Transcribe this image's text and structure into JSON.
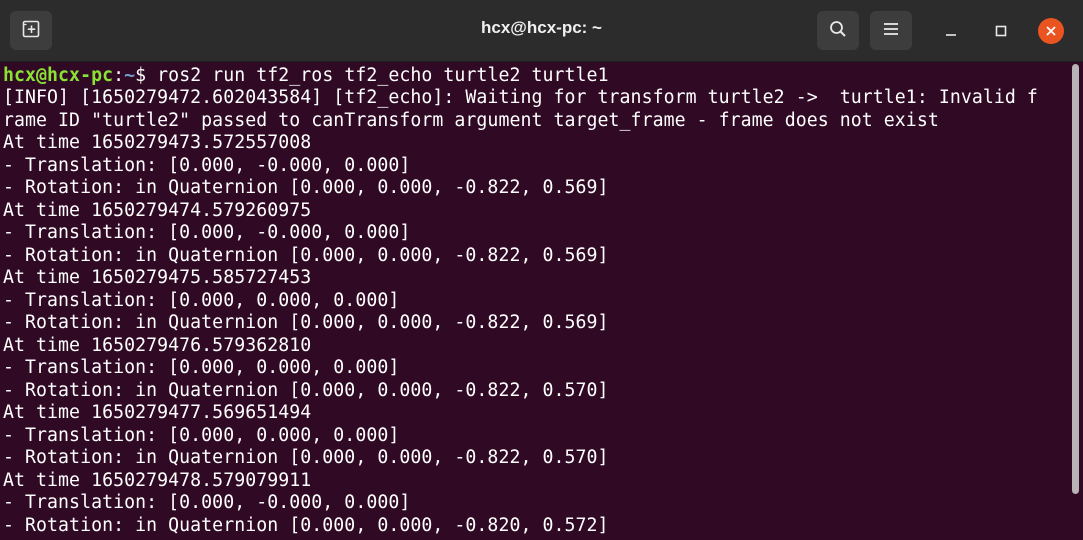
{
  "window": {
    "title": "hcx@hcx-pc: ~"
  },
  "titlebar": {
    "new_tab_icon": "new-tab-icon",
    "search_icon": "search-icon",
    "menu_icon": "hamburger-menu-icon",
    "minimize_icon": "minimize-icon",
    "maximize_icon": "maximize-icon",
    "close_icon": "close-icon",
    "close_color": "#e95420"
  },
  "terminal": {
    "background": "#300a24",
    "prompt": {
      "user_host": "hcx@hcx-pc",
      "separator": ":",
      "path": "~",
      "symbol": "$ ",
      "command": "ros2 run tf2_ros tf2_echo turtle2 turtle1"
    },
    "lines": [
      "[INFO] [1650279472.602043584] [tf2_echo]: Waiting for transform turtle2 ->  turtle1: Invalid f",
      "rame ID \"turtle2\" passed to canTransform argument target_frame - frame does not exist",
      "At time 1650279473.572557008",
      "- Translation: [0.000, -0.000, 0.000]",
      "- Rotation: in Quaternion [0.000, 0.000, -0.822, 0.569]",
      "At time 1650279474.579260975",
      "- Translation: [0.000, -0.000, 0.000]",
      "- Rotation: in Quaternion [0.000, 0.000, -0.822, 0.569]",
      "At time 1650279475.585727453",
      "- Translation: [0.000, 0.000, 0.000]",
      "- Rotation: in Quaternion [0.000, 0.000, -0.822, 0.569]",
      "At time 1650279476.579362810",
      "- Translation: [0.000, 0.000, 0.000]",
      "- Rotation: in Quaternion [0.000, 0.000, -0.822, 0.570]",
      "At time 1650279477.569651494",
      "- Translation: [0.000, 0.000, 0.000]",
      "- Rotation: in Quaternion [0.000, 0.000, -0.822, 0.570]",
      "At time 1650279478.579079911",
      "- Translation: [0.000, -0.000, 0.000]",
      "- Rotation: in Quaternion [0.000, 0.000, -0.820, 0.572]"
    ]
  },
  "colors": {
    "prompt_user": "#8ae234",
    "prompt_path": "#729fcf",
    "text": "#ffffff",
    "titlebar": "#2c2c2c"
  }
}
